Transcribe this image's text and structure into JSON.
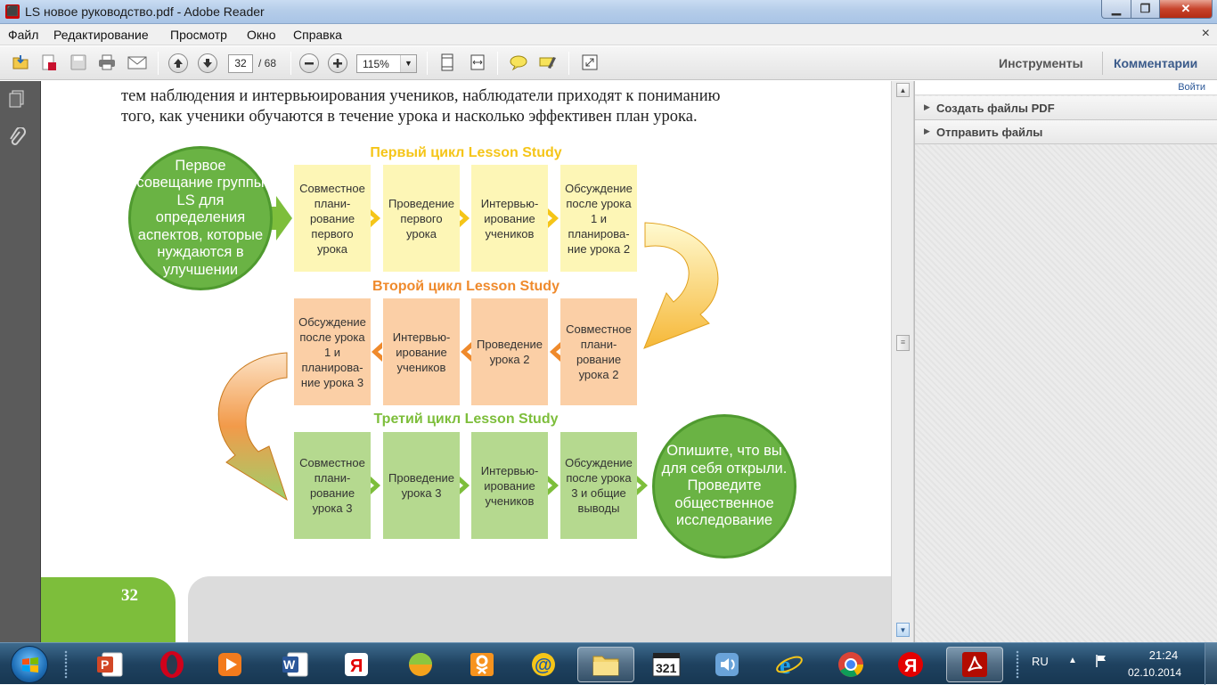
{
  "window": {
    "title": "LS новое руководство.pdf - Adobe Reader",
    "app_icon": "pdf-icon"
  },
  "window_controls": {
    "minimize": "▁",
    "maximize": "❐",
    "close": "✕"
  },
  "menu": {
    "items": [
      "Файл",
      "Редактирование",
      "Просмотр",
      "Окно",
      "Справка"
    ],
    "close_glyph": "×"
  },
  "toolbar": {
    "icons": [
      "open-icon",
      "create-pdf-icon",
      "save-icon",
      "print-icon",
      "email-icon",
      "prev-page-icon",
      "next-page-icon",
      "zoom-out-icon",
      "zoom-in-icon",
      "fit-page-icon",
      "fit-width-icon",
      "comment-icon",
      "highlight-icon",
      "fullscreen-icon"
    ],
    "page_current": "32",
    "page_total": "/ 68",
    "zoom": "115%",
    "tools": "Инструменты",
    "comments": "Комментарии"
  },
  "document": {
    "text_line1": "тем наблюдения и интервьюирования учеников, наблюдатели приходят к пониманию",
    "text_line2": "того, как ученики обучаются в течение урока и насколько эффективен план урока.",
    "cycle1": {
      "title": "Первый цикл Lesson Study",
      "boxes": [
        "Совместное плани-рование первого урока",
        "Проведение первого урока",
        "Интервью-ирование учеников",
        "Обсуждение после урока 1 и планирова-ние урока 2"
      ]
    },
    "cycle2": {
      "title": "Второй цикл Lesson Study",
      "boxes": [
        "Обсуждение после урока 1 и планирова-ние урока 3",
        "Интервью-ирование учеников",
        "Проведение урока 2",
        "Совместное плани-рование урока 2"
      ]
    },
    "cycle3": {
      "title": "Третий цикл Lesson Study",
      "boxes": [
        "Совместное плани-рование урока 3",
        "Проведение урока 3",
        "Интервью-ирование учеников",
        "Обсуждение после урока 3 и общие выводы"
      ]
    },
    "start_circle": "Первое совещание группы LS для определения аспектов, которые нуждаются в улучшении",
    "end_circle": "Опишите, что вы для себя открыли. Проведите общественное исследование",
    "page_number": "32",
    "colors": {
      "yellow_title": "#f5c518",
      "orange_title": "#ef8a2c",
      "green_title": "#7dbe3b",
      "circle": "#6ab344"
    }
  },
  "right_pane": {
    "login": "Войти",
    "sections": [
      "Создать файлы PDF",
      "Отправить файлы"
    ]
  },
  "taskbar": {
    "apps": [
      "powerpoint-icon",
      "opera-icon",
      "media-player-icon",
      "word-icon",
      "yandex-browser-icon",
      "browser-ball-icon",
      "odnoklassniki-icon",
      "mail-icon",
      "explorer-icon",
      "media-classic-icon",
      "volume-icon",
      "internet-explorer-icon",
      "chrome-icon",
      "yandex-icon",
      "adobe-reader-icon"
    ],
    "language": "RU",
    "time": "21:24",
    "date": "02.10.2014"
  }
}
